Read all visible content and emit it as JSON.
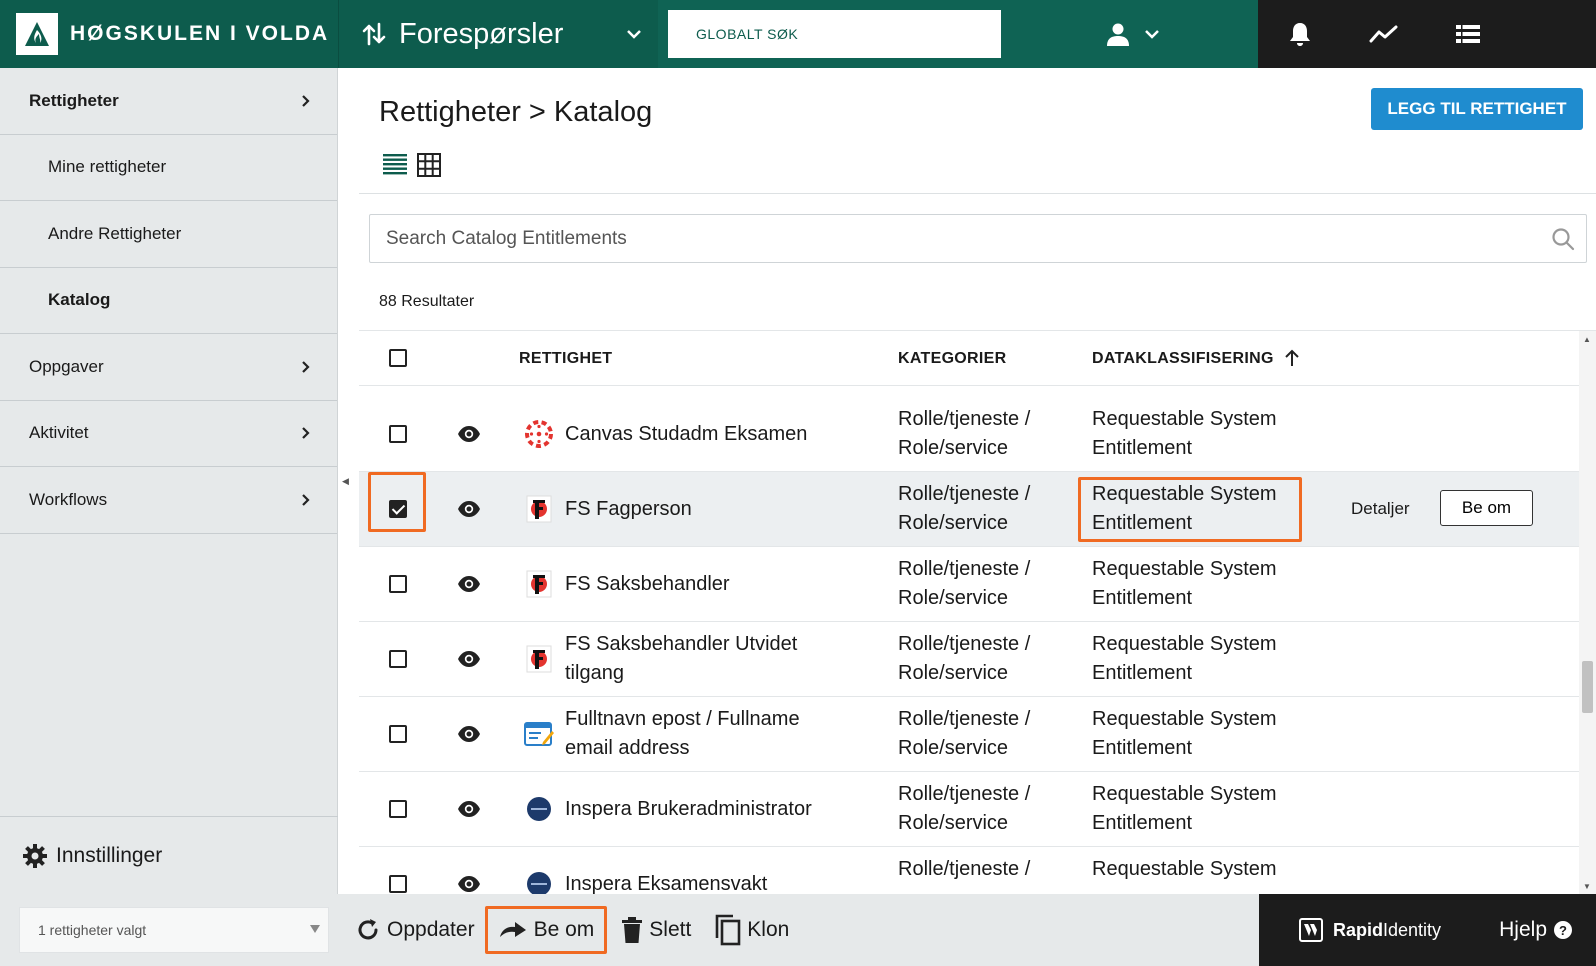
{
  "brand": {
    "name": "HØGSKULEN I VOLDA"
  },
  "header": {
    "module_title": "Forespørsler",
    "global_search_placeholder": "GLOBALT SØK"
  },
  "sidebar": {
    "items": [
      {
        "label": "Rettigheter"
      },
      {
        "label": "Mine rettigheter"
      },
      {
        "label": "Andre Rettigheter"
      },
      {
        "label": "Katalog"
      },
      {
        "label": "Oppgaver"
      },
      {
        "label": "Aktivitet"
      },
      {
        "label": "Workflows"
      }
    ],
    "settings_label": "Innstillinger"
  },
  "main": {
    "title": "Rettigheter > Katalog",
    "add_button": "LEGG TIL RETTIGHET",
    "search_placeholder": "Search Catalog Entitlements",
    "results": "88 Resultater"
  },
  "table": {
    "headers": {
      "entitlement": "RETTIGHET",
      "categories": "KATEGORIER",
      "classification": "DATAKLASSIFISERING"
    },
    "rows": [
      {
        "name": "Canvas Studadm Eksamen",
        "category": "Rolle/tjeneste / Role/service",
        "classification": "Requestable System Entitlement",
        "checked": false
      },
      {
        "name": "FS Fagperson",
        "category": "Rolle/tjeneste / Role/service",
        "classification": "Requestable System Entitlement",
        "checked": true
      },
      {
        "name": "FS Saksbehandler",
        "category": "Rolle/tjeneste / Role/service",
        "classification": "Requestable System Entitlement",
        "checked": false
      },
      {
        "name": "FS Saksbehandler Utvidet tilgang",
        "category": "Rolle/tjeneste / Role/service",
        "classification": "Requestable System Entitlement",
        "checked": false
      },
      {
        "name": "Fulltnavn epost / Fullname email address",
        "category": "Rolle/tjeneste / Role/service",
        "classification": "Requestable System Entitlement",
        "checked": false
      },
      {
        "name": "Inspera Brukeradministrator",
        "category": "Rolle/tjeneste / Role/service",
        "classification": "Requestable System Entitlement",
        "checked": false
      },
      {
        "name": "Inspera Eksamensvakt",
        "category": "Rolle/tjeneste /",
        "classification": "Requestable System",
        "checked": false
      }
    ],
    "selected_actions": {
      "details": "Detaljer",
      "request": "Be om"
    }
  },
  "bottombar": {
    "selection": "1 rettigheter valgt",
    "refresh": "Oppdater",
    "request": "Be om",
    "delete": "Slett",
    "clone": "Klon",
    "rapid_bold": "Rapid",
    "rapid_light": "Identity",
    "help": "Hjelp"
  },
  "colors": {
    "header_green": "#0d5c4d",
    "accent_blue": "#1f8ccf",
    "highlight_orange": "#f06a22",
    "dark": "#1c1c1c"
  }
}
